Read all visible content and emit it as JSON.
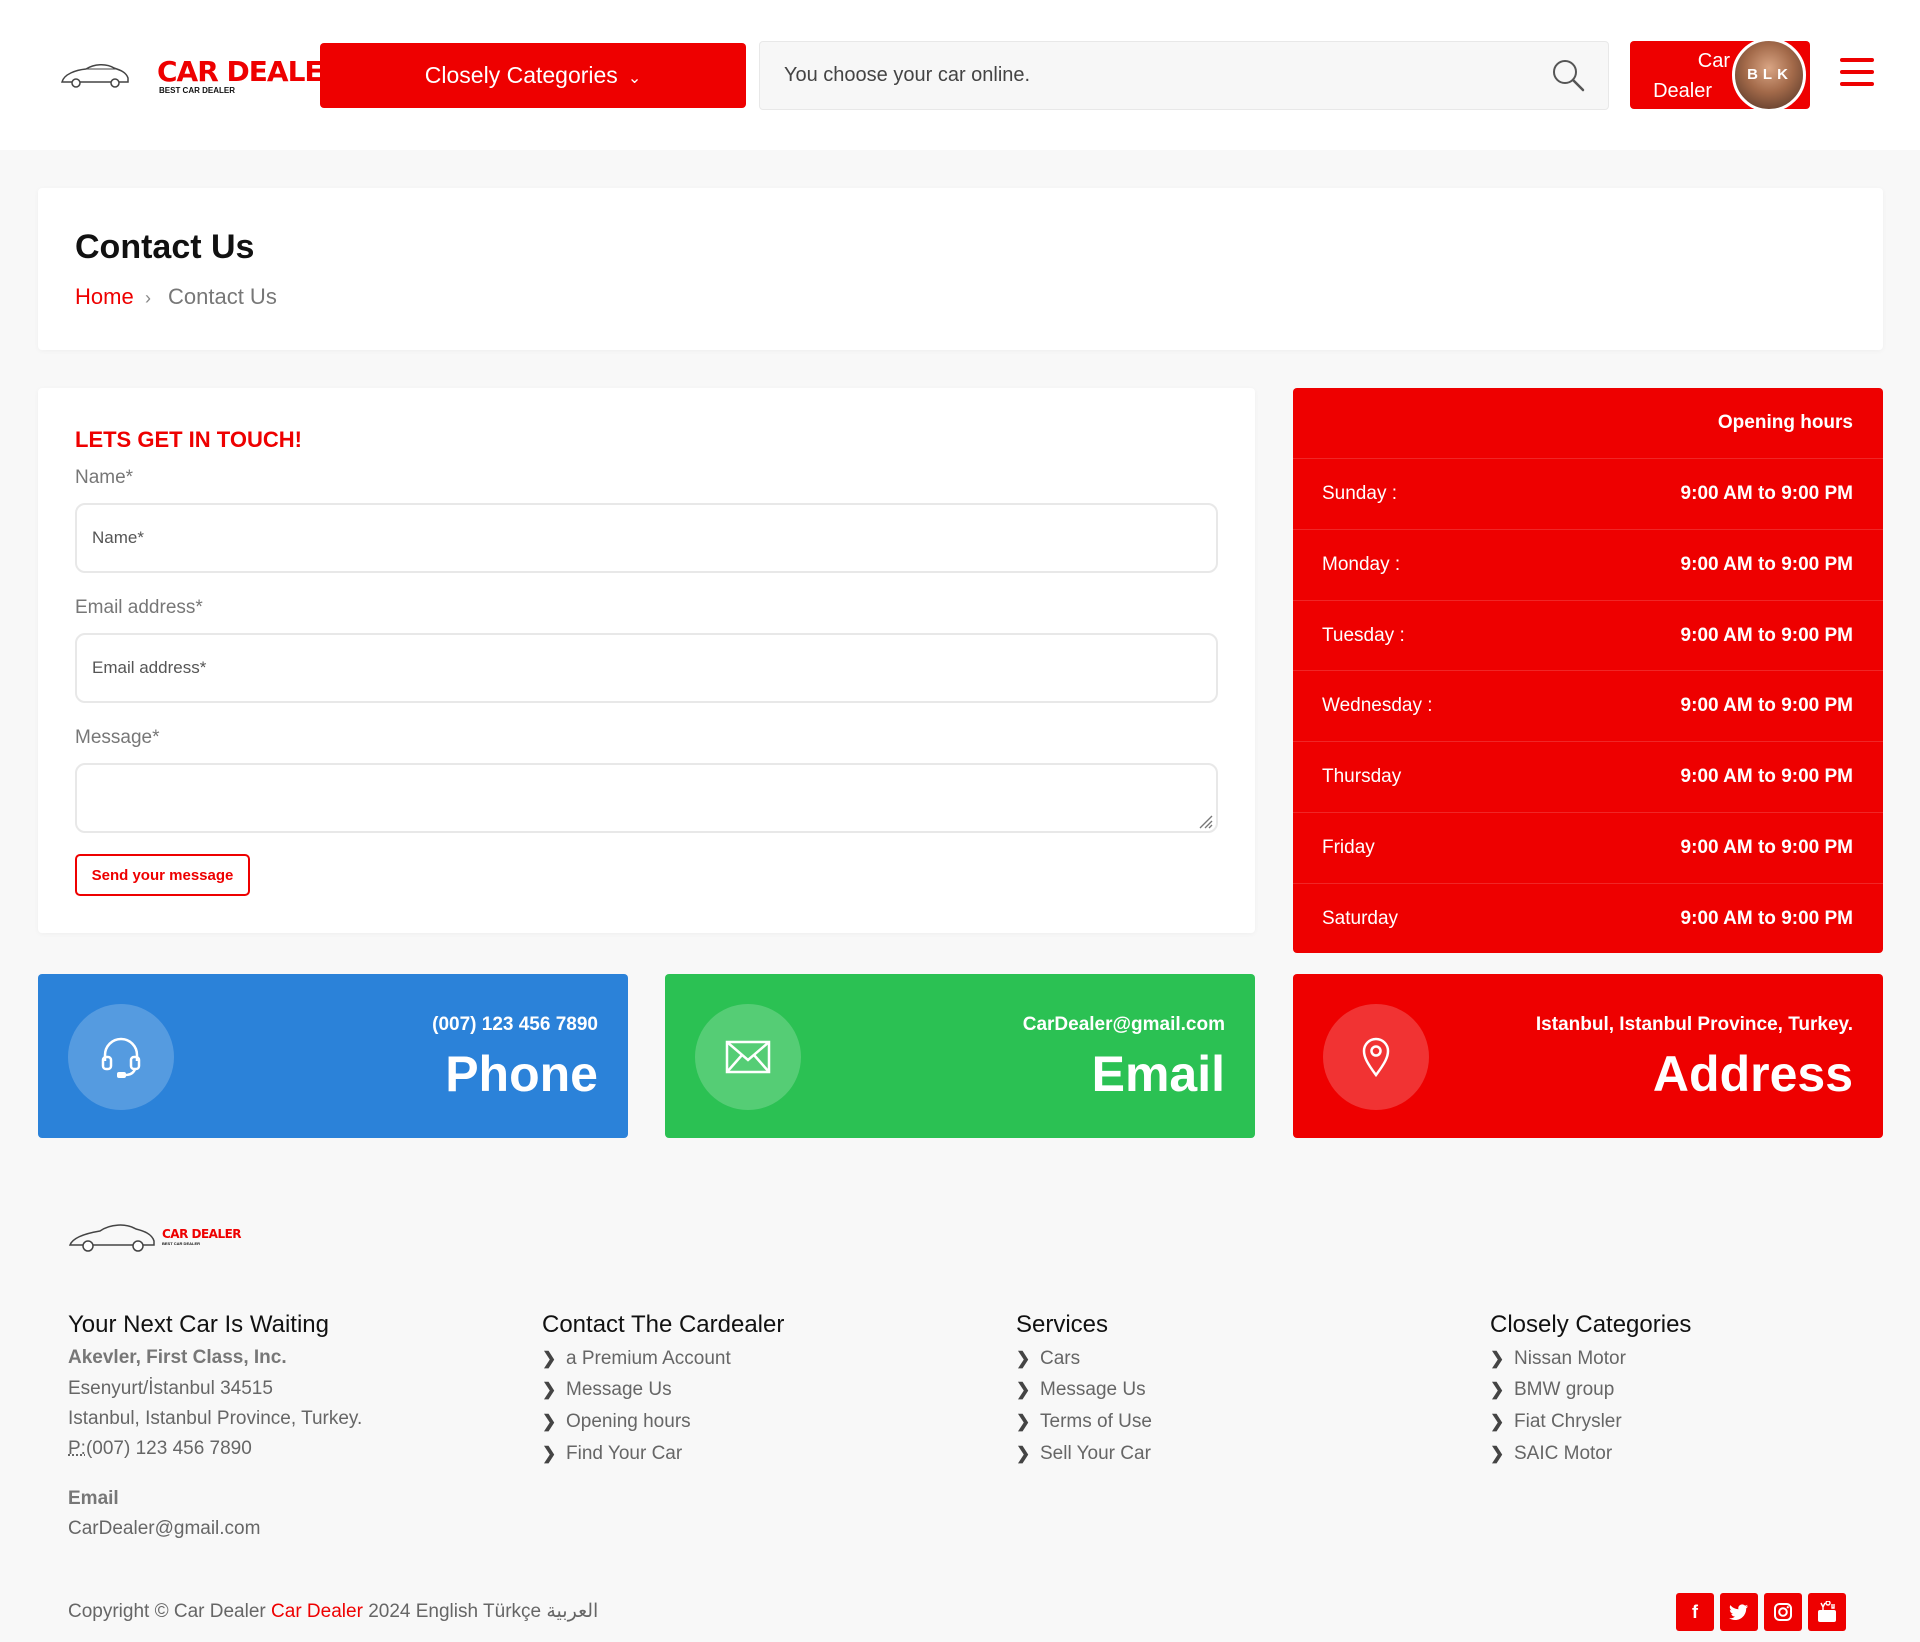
{
  "header": {
    "logo_text": "CAR DEALER",
    "logo_sub": "BEST CAR DEALER",
    "categories_button": "Closely Categories",
    "search_placeholder": "You choose your car online.",
    "user_label_line1": "Car",
    "user_label_line2": "Dealer",
    "avatar_text": "BLK"
  },
  "page": {
    "title": "Contact Us",
    "breadcrumb": {
      "home": "Home",
      "separator": ">",
      "current": "Contact Us"
    }
  },
  "form": {
    "heading": "LETS GET IN TOUCH!",
    "name_label": "Name*",
    "name_placeholder": "Name*",
    "email_label": "Email address*",
    "email_placeholder": "Email address*",
    "message_label": "Message*",
    "submit_label": "Send your message"
  },
  "hours": {
    "title": "Opening hours",
    "rows": [
      {
        "day": "Sunday :",
        "time": "9:00 AM to 9:00 PM"
      },
      {
        "day": "Monday :",
        "time": "9:00 AM to 9:00 PM"
      },
      {
        "day": "Tuesday :",
        "time": "9:00 AM to 9:00 PM"
      },
      {
        "day": "Wednesday :",
        "time": "9:00 AM to 9:00 PM"
      },
      {
        "day": "Thursday",
        "time": "9:00 AM to 9:00 PM"
      },
      {
        "day": "Friday",
        "time": "9:00 AM to 9:00 PM"
      },
      {
        "day": "Saturday",
        "time": "9:00 AM to 9:00 PM"
      }
    ]
  },
  "contact_boxes": [
    {
      "detail": "(007) 123 456 7890",
      "label": "Phone",
      "color": "#2b82d9",
      "icon": "headset-icon"
    },
    {
      "detail": "CarDealer@gmail.com",
      "label": "Email",
      "color": "#2bc153",
      "icon": "envelope-icon"
    },
    {
      "detail": "Istanbul, Istanbul Province, Turkey.",
      "label": "Address",
      "color": "#ee0000",
      "icon": "map-pin-icon"
    }
  ],
  "footer": {
    "logo_text": "CAR DEALER",
    "logo_sub": "BEST CAR DEALER",
    "col1": {
      "title": "Your Next Car Is Waiting",
      "company": "Akevler, First Class, Inc.",
      "address1": "Esenyurt/İstanbul 34515",
      "address2": "Istanbul, Istanbul Province, Turkey.",
      "phone_prefix": "P:",
      "phone": "(007) 123 456 7890",
      "email_title": "Email",
      "email": "CarDealer@gmail.com"
    },
    "col2": {
      "title": "Contact The Cardealer",
      "links": [
        "a Premium Account",
        "Message Us",
        "Opening hours",
        "Find Your Car"
      ]
    },
    "col3": {
      "title": "Services",
      "links": [
        "Cars",
        "Message Us",
        "Terms of Use",
        "Sell Your Car"
      ]
    },
    "col4": {
      "title": "Closely Categories",
      "links": [
        "Nissan Motor",
        "BMW group",
        "Fiat Chrysler",
        "SAIC Motor"
      ]
    },
    "copyright_prefix": "Copyright © Car Dealer",
    "copyright_brand": "Car Dealer",
    "copyright_year": "2024",
    "languages": [
      "English",
      "Türkçe",
      "العربية"
    ],
    "social": [
      "facebook-icon",
      "twitter-icon",
      "instagram-icon",
      "youtube-icon"
    ]
  },
  "colors": {
    "accent": "#ee0000",
    "phone": "#2b82d9",
    "email": "#2bc153"
  }
}
